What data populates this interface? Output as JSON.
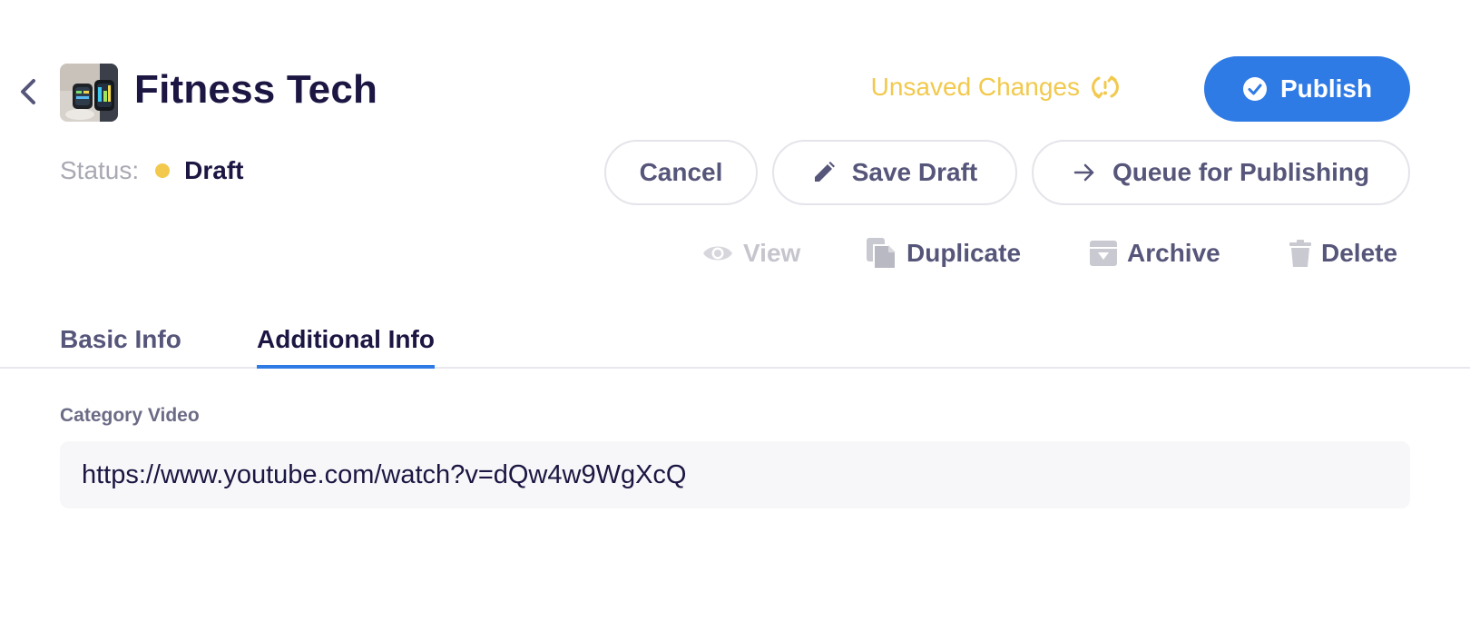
{
  "header": {
    "title": "Fitness Tech",
    "unsaved_text": "Unsaved Changes",
    "publish_label": "Publish"
  },
  "status": {
    "label": "Status:",
    "value": "Draft",
    "dot_color": "#f2c94c"
  },
  "buttons": {
    "cancel": "Cancel",
    "save_draft": "Save Draft",
    "queue": "Queue for Publishing"
  },
  "actions": {
    "view": "View",
    "duplicate": "Duplicate",
    "archive": "Archive",
    "delete": "Delete"
  },
  "tabs": [
    {
      "label": "Basic Info",
      "active": false
    },
    {
      "label": "Additional Info",
      "active": true
    }
  ],
  "form": {
    "category_video_label": "Category Video",
    "category_video_value": "https://www.youtube.com/watch?v=dQw4w9WgXcQ"
  },
  "colors": {
    "accent": "#2f7be5",
    "warning": "#f2c94c",
    "text_dark": "#1b1642",
    "text_muted": "#56557a"
  },
  "icons": {
    "back": "chevron-left-icon",
    "unsaved": "sync-alert-icon",
    "publish": "check-circle-icon",
    "save_draft": "pencil-icon",
    "queue": "arrow-right-icon",
    "view": "eye-icon",
    "duplicate": "copy-icon",
    "archive": "archive-icon",
    "delete": "trash-icon"
  }
}
